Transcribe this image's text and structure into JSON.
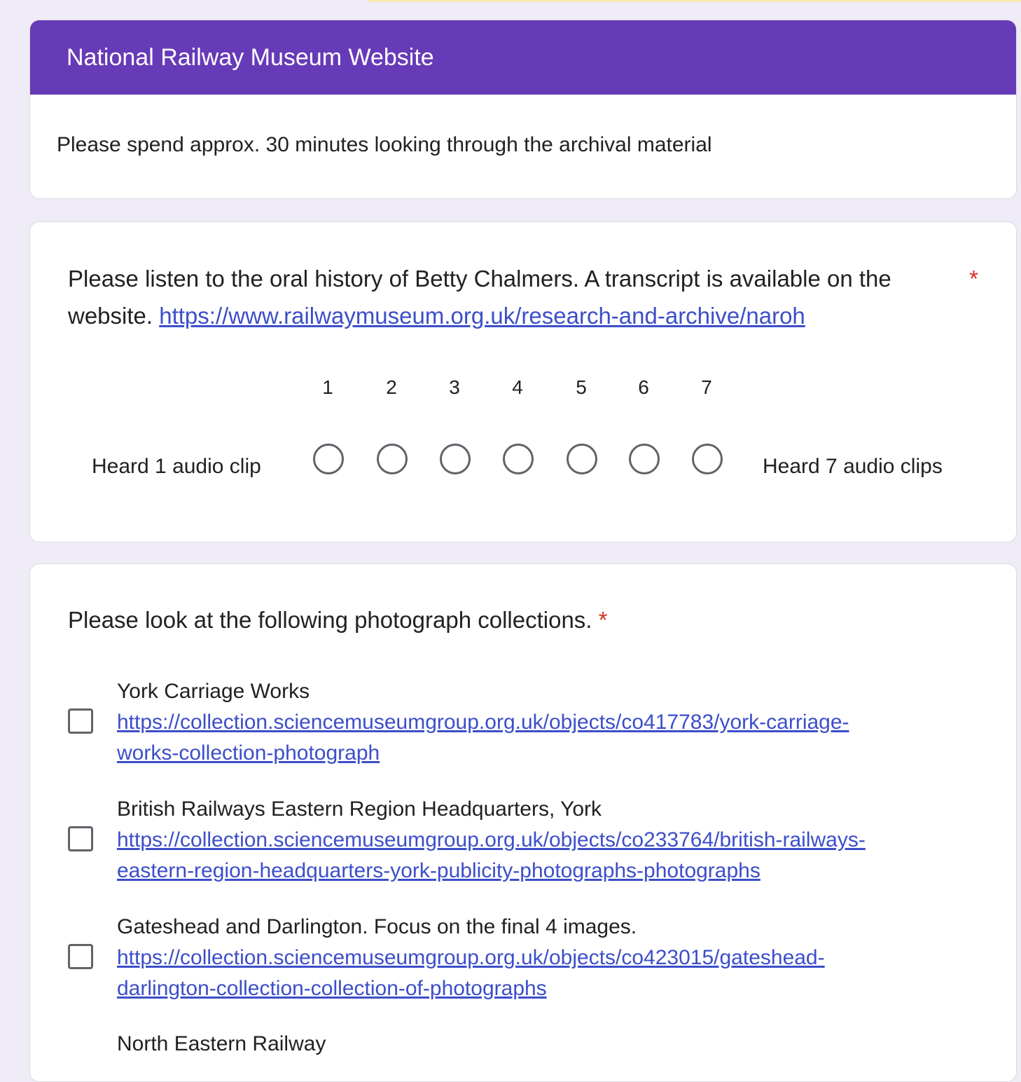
{
  "form": {
    "title": "National Railway Museum Website",
    "description": "Please spend approx. 30 minutes looking through the archival material"
  },
  "question1": {
    "text": "Please listen to the oral history of Betty Chalmers. A transcript is available on the website.",
    "link": "https://www.railwaymuseum.org.uk/research-and-archive/naroh",
    "required_mark": "*",
    "scale": [
      "1",
      "2",
      "3",
      "4",
      "5",
      "6",
      "7"
    ],
    "low_label": "Heard 1 audio clip",
    "high_label": "Heard 7 audio clips"
  },
  "question2": {
    "text": "Please look at the following photograph collections.",
    "required_mark": "*",
    "options": [
      {
        "label": "York Carriage Works",
        "link_line1": "https://collection.sciencemuseumgroup.org.uk/objects/co417783/york-carriage-",
        "link_line2": "works-collection-photograph"
      },
      {
        "label": "British Railways Eastern Region Headquarters, York",
        "link_line1": "https://collection.sciencemuseumgroup.org.uk/objects/co233764/british-railways-",
        "link_line2": "eastern-region-headquarters-york-publicity-photographs-photographs"
      },
      {
        "label": "Gateshead and Darlington. Focus on the final 4 images.",
        "link_line1": "https://collection.sciencemuseumgroup.org.uk/objects/co423015/gateshead-",
        "link_line2": "darlington-collection-collection-of-photographs"
      },
      {
        "label": "North Eastern Railway"
      }
    ]
  },
  "colors": {
    "header": "#673ab7",
    "background": "#efebf7",
    "required": "#d93025",
    "link": "#3c4ec9"
  }
}
